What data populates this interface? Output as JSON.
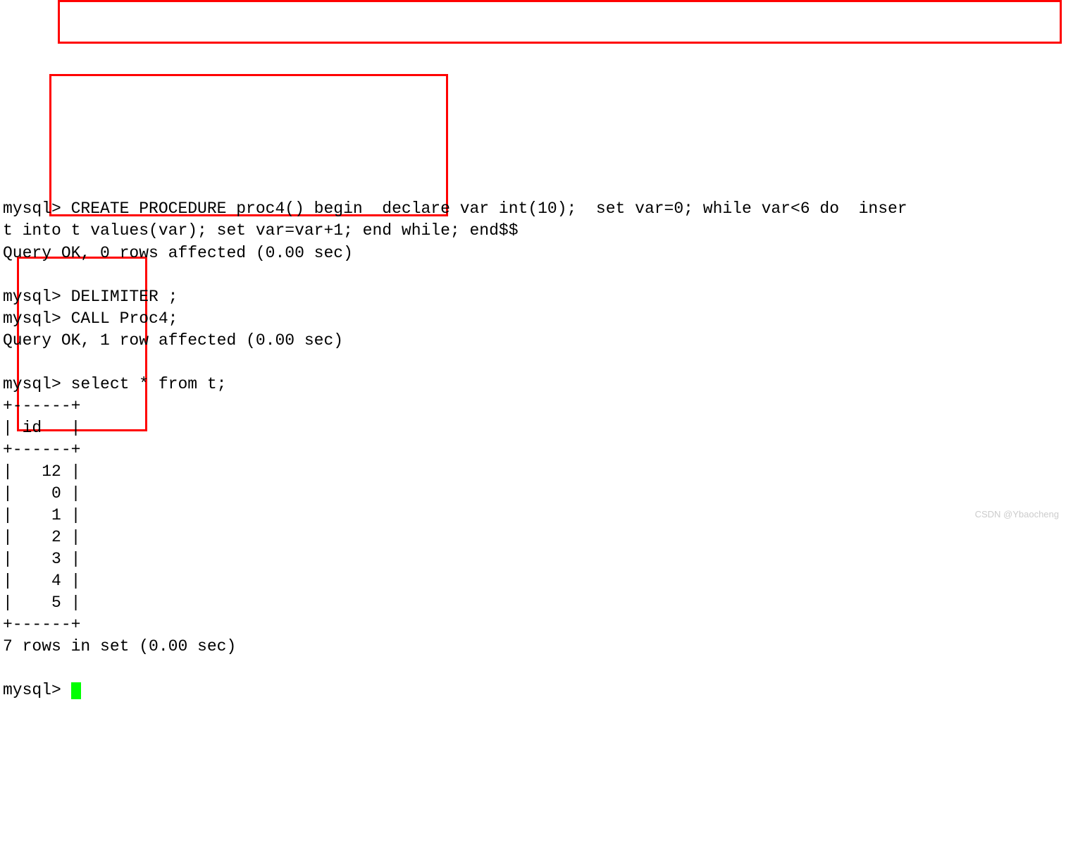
{
  "lines": {
    "l01": "mysql> CREATE PROCEDURE proc4() begin  declare var int(10);  set var=0; while var<6 do  inser",
    "l02": "t into t values(var); set var=var+1; end while; end$$",
    "l03": "Query OK, 0 rows affected (0.00 sec)",
    "l04": "",
    "l05": "mysql> DELIMITER ;",
    "l06": "mysql> CALL Proc4;",
    "l07": "Query OK, 1 row affected (0.00 sec)",
    "l08": "",
    "l09": "mysql> select * from t;",
    "l10": "+------+",
    "l11": "| id   |",
    "l12": "+------+",
    "l13": "|   12 |",
    "l14": "|    0 |",
    "l15": "|    1 |",
    "l16": "|    2 |",
    "l17": "|    3 |",
    "l18": "|    4 |",
    "l19": "|    5 |",
    "l20": "+------+",
    "l21": "7 rows in set (0.00 sec)",
    "l22": "",
    "l23": "mysql> "
  },
  "watermark": "CSDN @Ybaocheng"
}
